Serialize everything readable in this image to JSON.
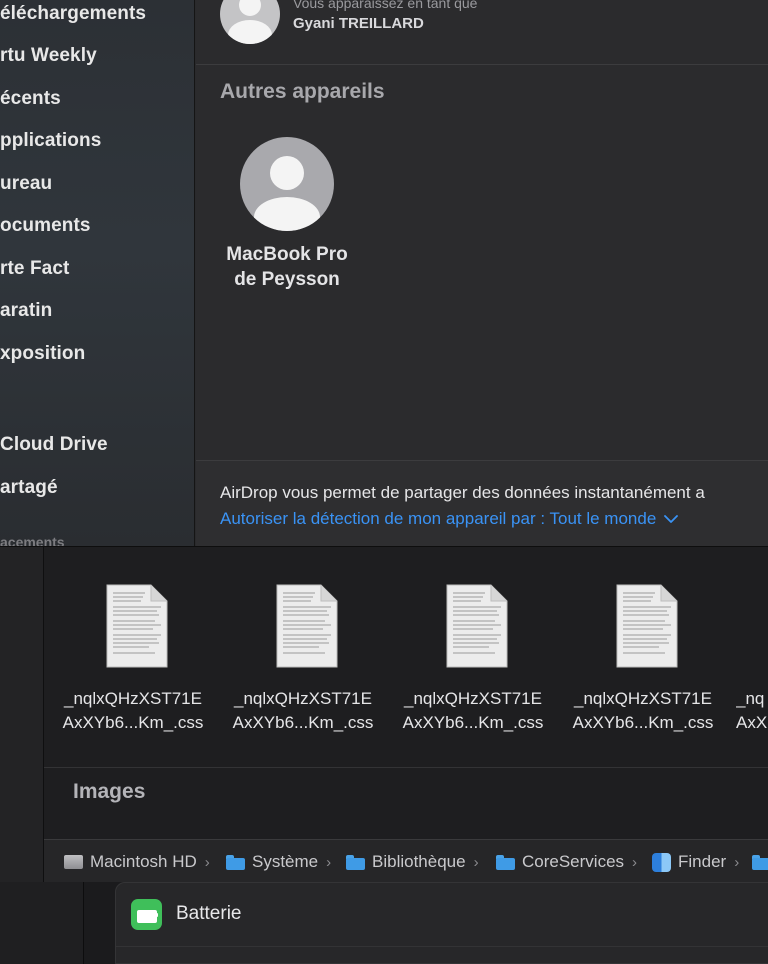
{
  "airdrop": {
    "sidebar": {
      "items": [
        {
          "label": "éléchargements"
        },
        {
          "label": "rtu Weekly"
        },
        {
          "label": "écents"
        },
        {
          "label": "pplications"
        },
        {
          "label": "ureau"
        },
        {
          "label": "ocuments"
        },
        {
          "label": "rte Fact"
        },
        {
          "label": "aratin"
        },
        {
          "label": "xposition"
        },
        {
          "label": "Cloud Drive"
        },
        {
          "label": "artagé"
        }
      ],
      "section_partial": "acements"
    },
    "me": {
      "caption": "Vous apparaissez en tant que",
      "name": "Gyani TREILLARD",
      "icon": "person-icon"
    },
    "other_devices_title": "Autres appareils",
    "device": {
      "name_line1": "MacBook Pro",
      "name_line2": "de Peysson",
      "icon": "person-icon"
    },
    "info_text": "AirDrop vous permet de partager des données instantanément a",
    "detection_link": "Autoriser la détection de mon appareil par : Tout le monde",
    "link_color": "#3a93f5"
  },
  "finder": {
    "files": [
      {
        "line1": "_nqlxQHzXST71E",
        "line2": "AxXYb6...Km_.css"
      },
      {
        "line1": "_nqlxQHzXST71E",
        "line2": "AxXYb6...Km_.css"
      },
      {
        "line1": "_nqlxQHzXST71E",
        "line2": "AxXYb6...Km_.css"
      },
      {
        "line1": "_nqlxQHzXST71E",
        "line2": "AxXYb6...Km_.css"
      },
      {
        "line1": "_nq",
        "line2": "AxX"
      }
    ],
    "group_title": "Images",
    "path": [
      {
        "label": "Macintosh HD",
        "icon": "hard-drive-icon"
      },
      {
        "label": "Système",
        "icon": "folder-icon"
      },
      {
        "label": "Bibliothèque",
        "icon": "folder-icon"
      },
      {
        "label": "CoreServices",
        "icon": "folder-icon"
      },
      {
        "label": "Finder",
        "icon": "finder-icon"
      },
      {
        "label": "",
        "icon": "folder-icon"
      }
    ],
    "separator": "›"
  },
  "settings": {
    "battery_label": "Batterie",
    "battery_icon": "battery-icon",
    "battery_color": "#3fbf5a"
  }
}
